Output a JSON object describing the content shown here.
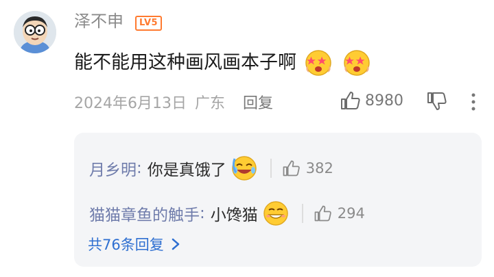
{
  "comment": {
    "username": "泽不申",
    "level_badge": "LV5",
    "text": "能不能用这种画风画本子啊",
    "emojis": [
      "star-eyes-emoji",
      "star-eyes-emoji"
    ],
    "date": "2024年6月13日",
    "location": "广东",
    "reply_label": "回复",
    "like_count": "8980",
    "icons": {
      "like": "thumbs-up-icon",
      "dislike": "thumbs-down-icon",
      "more": "more-vertical-icon"
    }
  },
  "replies": [
    {
      "name": "月乡明",
      "colon": ":",
      "text": "你是真饿了",
      "emoji": "laughing-tears-emoji",
      "likes": "382"
    },
    {
      "name": "猫猫章鱼的触手",
      "colon": ":",
      "text": "小馋猫",
      "emoji": "grinning-emoji",
      "likes": "294"
    }
  ],
  "more_replies_label": "共76条回复",
  "colors": {
    "accent_link": "#2e6fd1",
    "reply_name": "#6f7cab",
    "level_orange": "#ff7a2f"
  }
}
